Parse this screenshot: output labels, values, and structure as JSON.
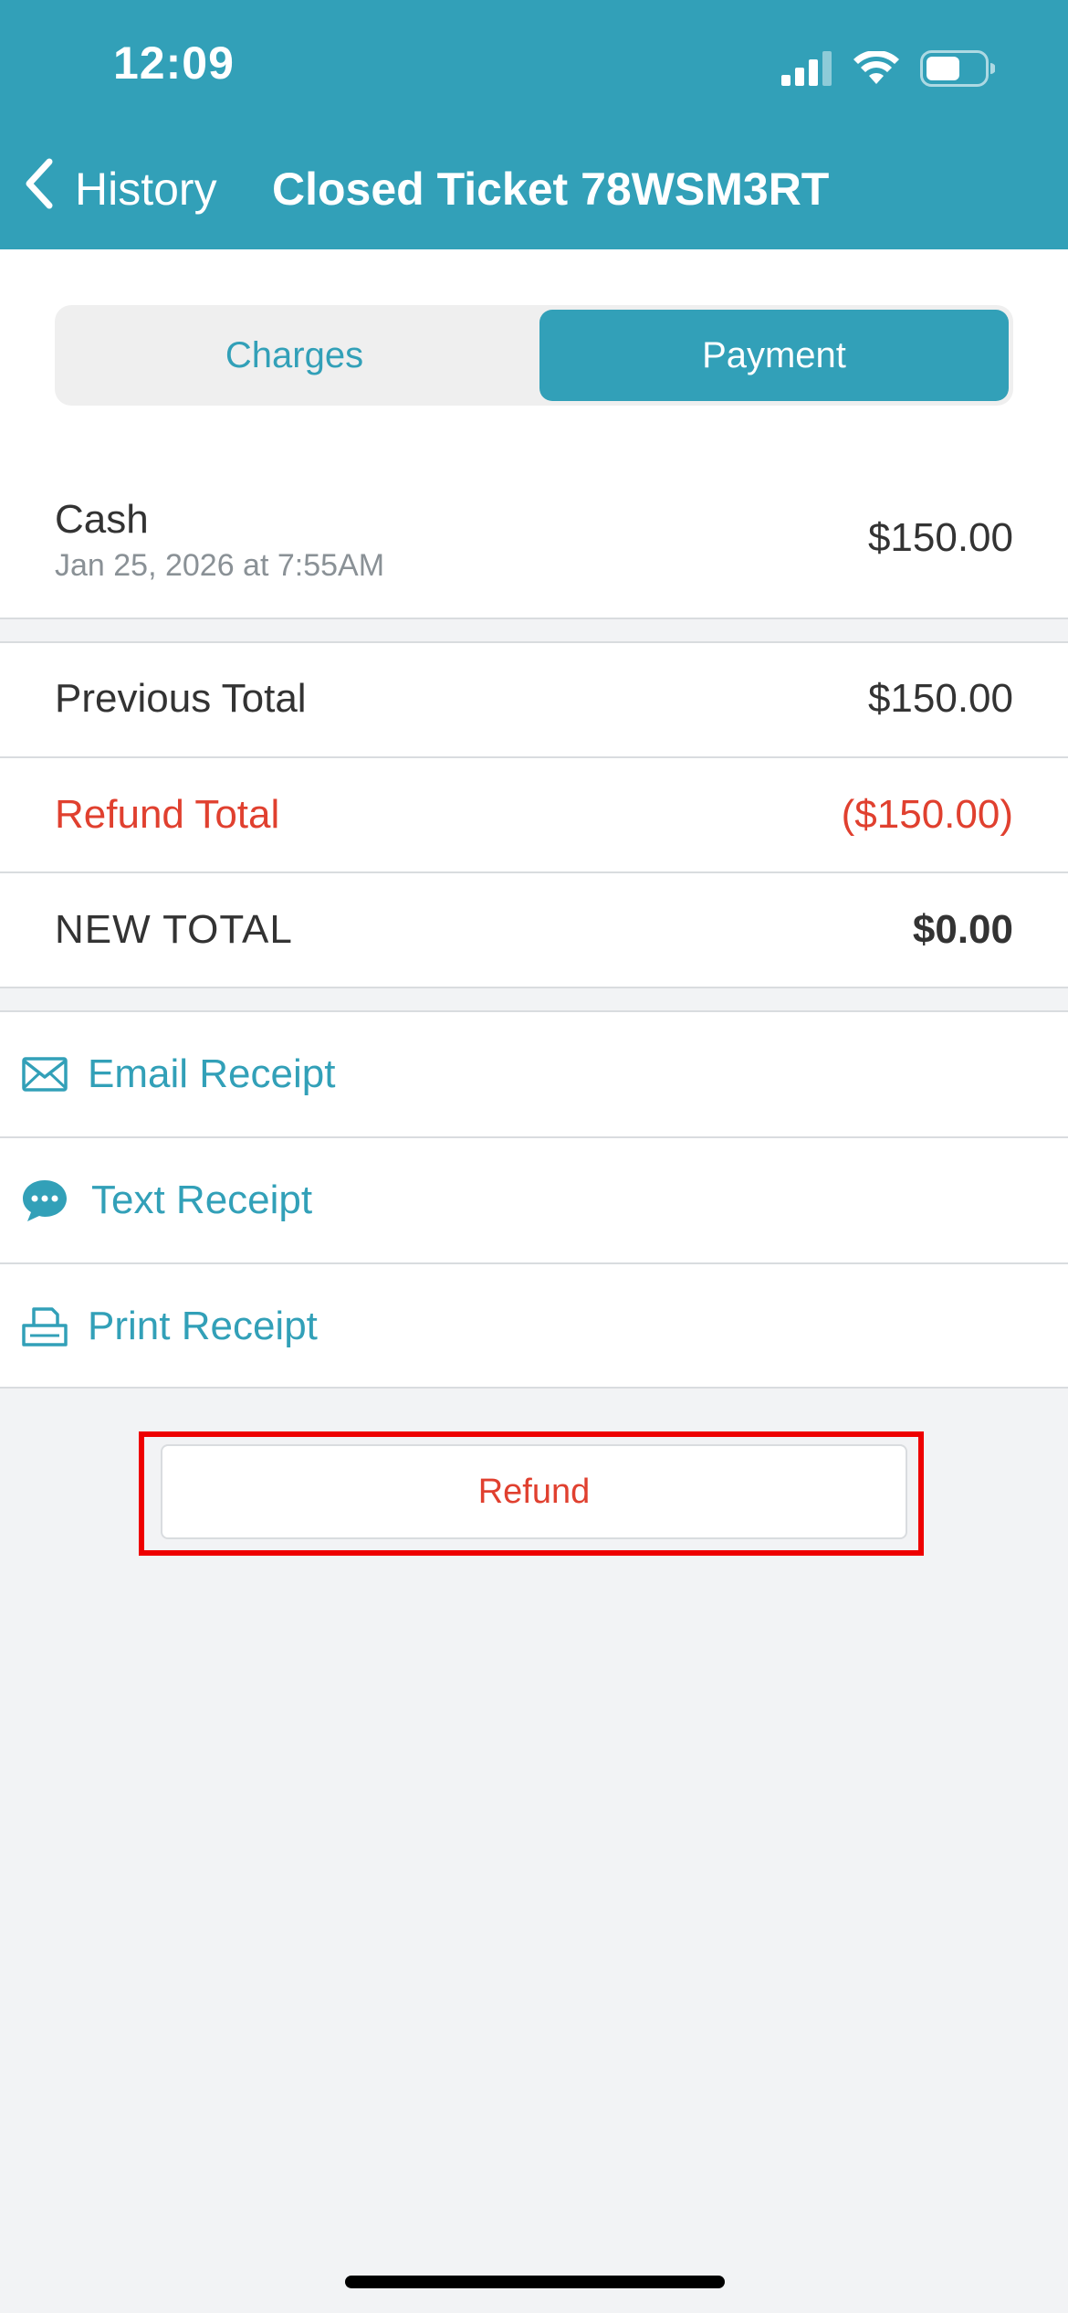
{
  "status_bar": {
    "time": "12:09"
  },
  "nav": {
    "back_label": "History",
    "title": "Closed Ticket 78WSM3RT"
  },
  "segments": {
    "charges": "Charges",
    "payment": "Payment",
    "selected": "Payment"
  },
  "payment": {
    "method": "Cash",
    "date": "Jan 25, 2026 at 7:55AM",
    "amount": "$150.00"
  },
  "totals": {
    "previous_label": "Previous Total",
    "previous_value": "$150.00",
    "refund_label": "Refund Total",
    "refund_value": "($150.00)",
    "new_label": "NEW TOTAL",
    "new_value": "$0.00"
  },
  "receipts": [
    {
      "label": "Email Receipt",
      "icon": "envelope-icon"
    },
    {
      "label": "Text Receipt",
      "icon": "chat-bubble-icon"
    },
    {
      "label": "Print Receipt",
      "icon": "printer-icon"
    }
  ],
  "refund_button": {
    "label": "Refund"
  },
  "colors": {
    "brand": "#32a0b8",
    "refund_red": "#e0402f",
    "highlight_red": "#ee0000",
    "background": "#f2f3f5"
  }
}
